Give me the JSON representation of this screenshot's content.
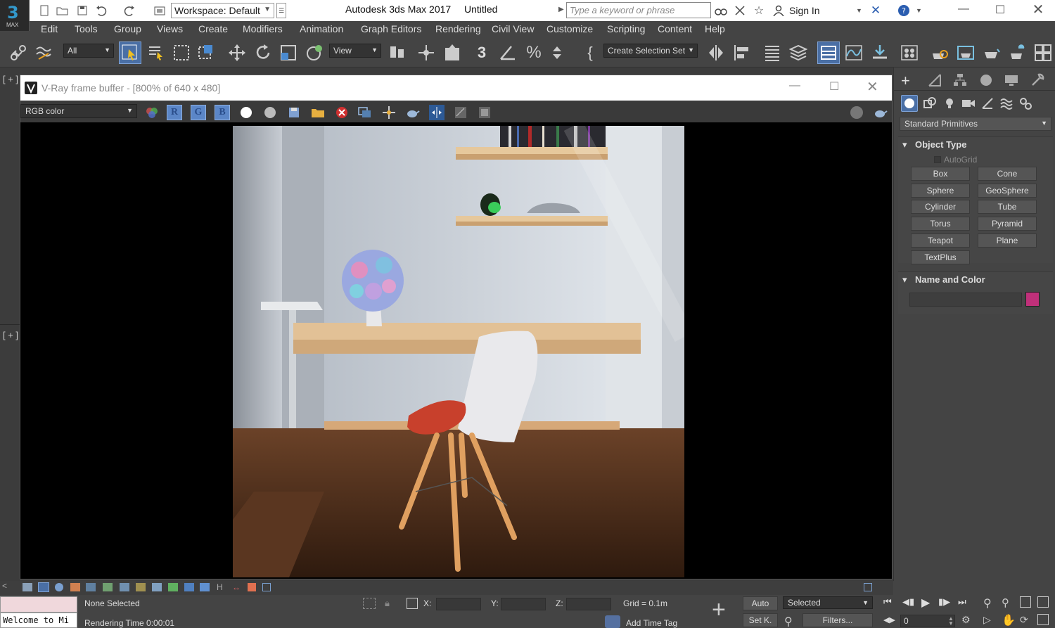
{
  "app": {
    "logo_text": "3",
    "logo_sub": "MAX",
    "workspace": "Workspace: Default",
    "title": "Autodesk 3ds Max 2017",
    "file": "Untitled",
    "search_placeholder": "Type a keyword or phrase",
    "sign_in": "Sign In"
  },
  "menu": [
    "Edit",
    "Tools",
    "Group",
    "Views",
    "Create",
    "Modifiers",
    "Animation",
    "Graph Editors",
    "Rendering",
    "Civil View",
    "Customize",
    "Scripting",
    "Content",
    "Help"
  ],
  "toolbar": {
    "selection_filter": "All",
    "ref_coord": "View",
    "selection_set": "Create Selection Set"
  },
  "viewport": {
    "label_top": "[ + ]",
    "label_bottom": "[ + ]"
  },
  "vfb": {
    "title": "V-Ray frame buffer - [800% of 640 x 480]",
    "channel": "RGB color",
    "r": "R",
    "g": "G",
    "b": "B"
  },
  "panel": {
    "category": "Standard Primitives",
    "object_type": "Object Type",
    "autogrid": "AutoGrid",
    "buttons": [
      "Box",
      "Cone",
      "Sphere",
      "GeoSphere",
      "Cylinder",
      "Tube",
      "Torus",
      "Pyramid",
      "Teapot",
      "Plane",
      "TextPlus"
    ],
    "name_color": "Name and Color",
    "object_color": "#c0307a"
  },
  "status": {
    "maxscript": "Welcome to Mi",
    "selection": "None Selected",
    "render_time": "Rendering Time  0:00:01",
    "x_label": "X:",
    "y_label": "Y:",
    "z_label": "Z:",
    "grid": "Grid = 0.1m",
    "add_time_tag": "Add Time Tag",
    "auto": "Auto",
    "set_key": "Set K.",
    "key_mode": "Selected",
    "filters": "Filters...",
    "frame": "0"
  }
}
